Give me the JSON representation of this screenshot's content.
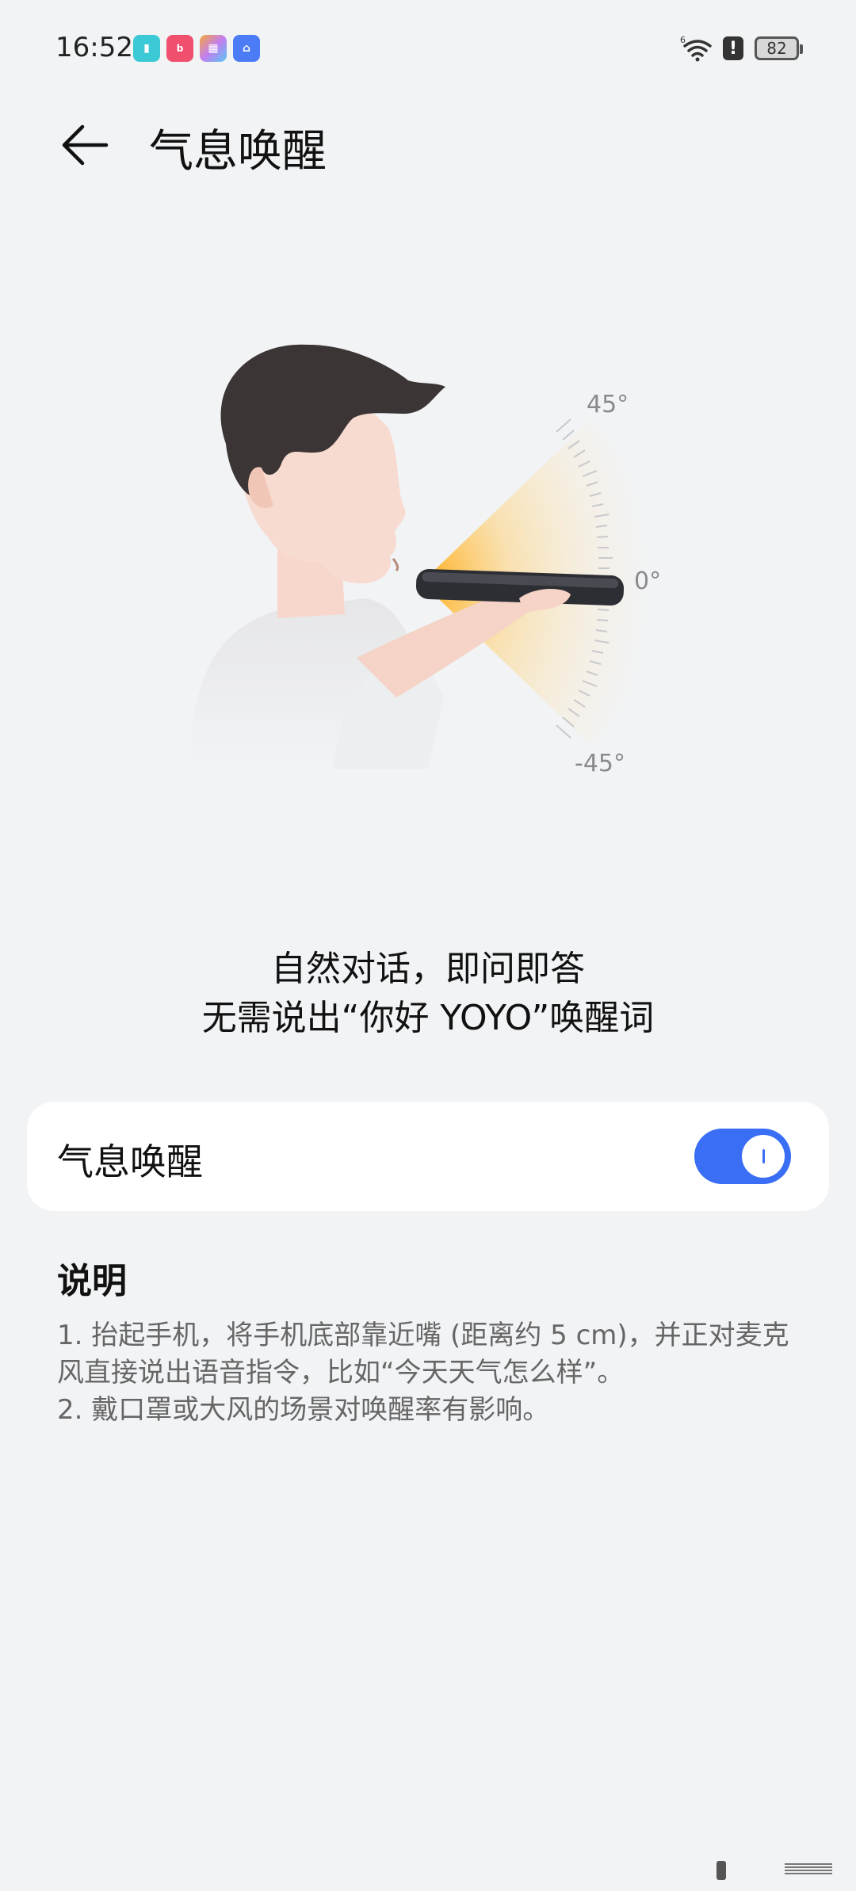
{
  "status_bar": {
    "time": "16:52",
    "battery": "82",
    "signal_label": "6",
    "apps": [
      {
        "name": "book-app-icon",
        "color": "#3cc9d6",
        "glyph": "▮"
      },
      {
        "name": "bilibili-app-icon",
        "color": "#f04f6e",
        "glyph": "b"
      },
      {
        "name": "colorful-app-icon",
        "color": "#f7a53b",
        "glyph": "▦"
      },
      {
        "name": "store-app-icon",
        "color": "#4b7bf5",
        "glyph": "⌂"
      }
    ]
  },
  "header": {
    "title": "气息唤醒"
  },
  "illustration": {
    "angle_top": "45°",
    "angle_mid": "0°",
    "angle_bottom": "-45°"
  },
  "intro": {
    "line1": "自然对话，即问即答",
    "line2": "无需说出“你好 YOYO”唤醒词"
  },
  "toggle_card": {
    "label": "气息唤醒",
    "enabled": true,
    "accent": "#3a6ef5"
  },
  "description": {
    "title": "说明",
    "items": [
      "1. 抬起手机，将手机底部靠近嘴 (距离约 5 cm)，并正对麦克风直接说出语音指令，比如“今天天气怎么样”。",
      "2. 戴口罩或大风的场景对唤醒率有影响。"
    ]
  }
}
